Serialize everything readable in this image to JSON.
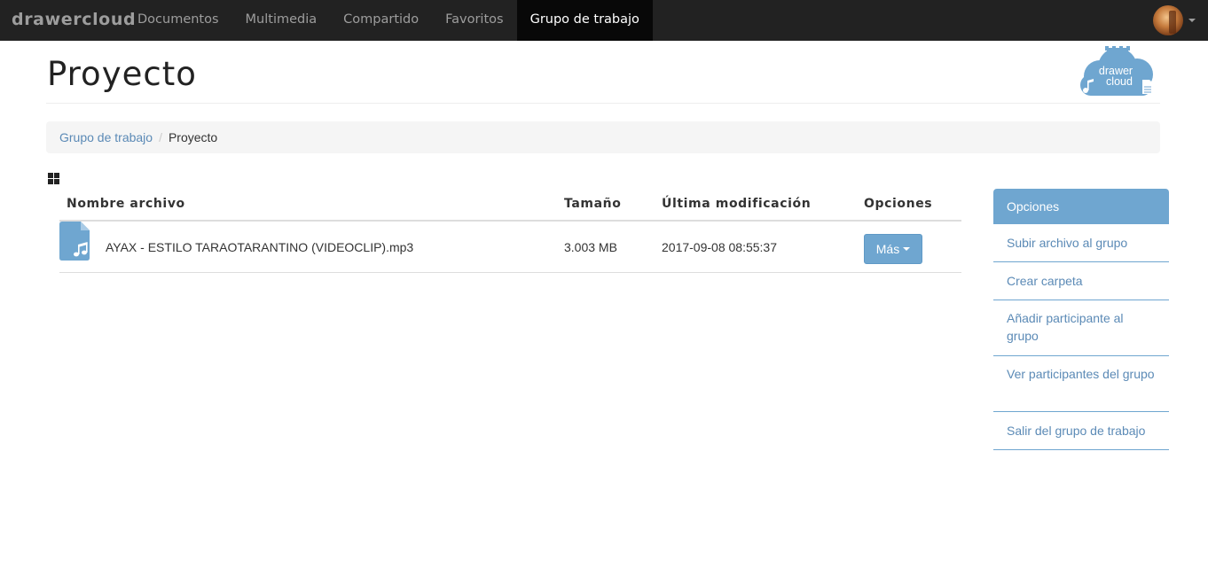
{
  "navbar": {
    "brand": "drawercloud",
    "items": [
      {
        "label": "Documentos"
      },
      {
        "label": "Multimedia"
      },
      {
        "label": "Compartido"
      },
      {
        "label": "Favoritos"
      },
      {
        "label": "Grupo de trabajo"
      }
    ],
    "active_item": "Grupo de trabajo"
  },
  "page": {
    "title": "Proyecto",
    "logo_text": [
      "drawer",
      "cloud"
    ]
  },
  "breadcrumb": {
    "parent": "Grupo de trabajo",
    "current": "Proyecto"
  },
  "table": {
    "headers": {
      "name": "Nombre archivo",
      "size": "Tamaño",
      "modified": "Última modificación",
      "options": "Opciones"
    },
    "rows": [
      {
        "icon": "audio-file-icon",
        "name": "AYAX - ESTILO TARAOTARANTINO (VIDEOCLIP).mp3",
        "size": "3.003 MB",
        "modified": "2017-09-08 08:55:37",
        "action_label": "Más"
      }
    ]
  },
  "options_panel": {
    "title": "Opciones",
    "items": [
      {
        "label": "Subir archivo al grupo"
      },
      {
        "label": "Crear carpeta"
      },
      {
        "label": "Añadir participante al grupo"
      },
      {
        "label": "Ver participantes del grupo"
      },
      {
        "label": "Salir del grupo de trabajo"
      }
    ]
  },
  "colors": {
    "navbar_bg": "#222222",
    "navbar_active_bg": "#080808",
    "accent": "#6fa6d0",
    "link": "#5b8ab6"
  }
}
